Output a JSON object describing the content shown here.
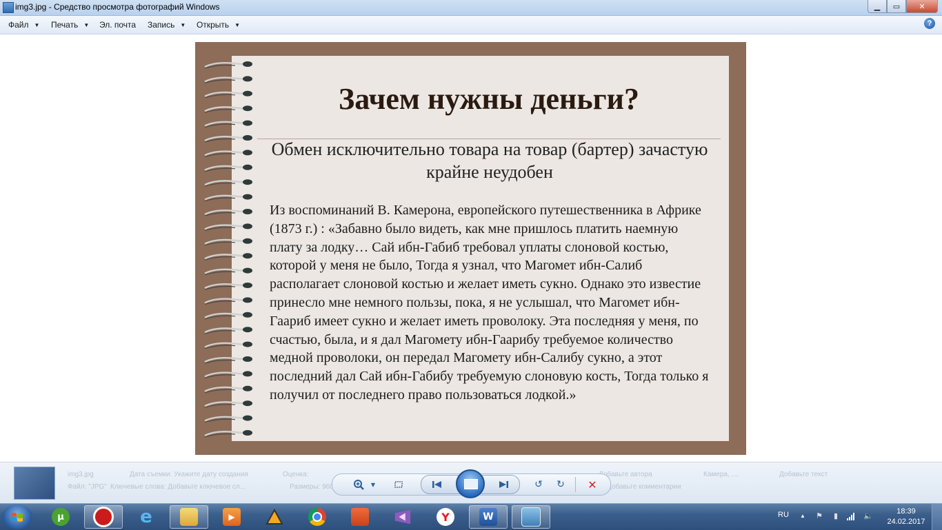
{
  "window": {
    "title": "img3.jpg - Средство просмотра фотографий Windows",
    "buttons": {
      "minimize": "▁",
      "maximize": "▭",
      "close": "✕"
    }
  },
  "menu": {
    "file": "Файл",
    "print": "Печать",
    "email": "Эл. почта",
    "burn": "Запись",
    "open": "Открыть",
    "help": "?"
  },
  "slide": {
    "title": "Зачем нужны деньги?",
    "subtitle": "Обмен исключительно товара на товар (бартер) зачастую крайне неудобен",
    "body": "Из воспоминаний В. Камерона, европейского путешественника в Африке (1873 г.) : «Забавно было видеть, как мне пришлось платить наемную плату за лодку… Сай ибн-Габиб требовал уплаты слоновой костью, которой у меня не было, Тогда я узнал, что Магомет ибн-Салиб располагает слоновой костью и желает иметь сукно. Однако это известие принесло мне немного пользы, пока, я не услышал, что Магомет ибн-Гаариб имеет сукно и желает иметь проволоку. Эта последняя у меня, по счастью, была, и я дал Магомету ибн-Гаарибу требуемое количество медной проволоки, он передал Магомету ибн-Салибу сукно, а этот последний дал Сай ибн-Габибу требуемую слоновую кость, Тогда только я получил от последнего право пользоваться лодкой.»"
  },
  "infobar": {
    "filename": "img3.jpg",
    "date_taken": "Дата съемки: Укажите дату создания",
    "rating": "Оценка:",
    "author": "Добавьте автора",
    "camera": "Камера, ....",
    "tags": "Добавьте текст",
    "size_label": "Файл: \"JPG\"",
    "keywords": "Ключевые слова: Добавьте ключевое сл...",
    "dims": "Размеры: 960 x 720",
    "comment": "Добавьте комментарии"
  },
  "controls": {
    "zoom": "🔍",
    "fit": "⬚",
    "prev": "⏮",
    "next": "⏭",
    "rotate_ccw": "↺",
    "rotate_cw": "↻",
    "delete": "✕"
  },
  "taskbar": {
    "apps": [
      "utorrent",
      "opera",
      "internet-explorer",
      "file-explorer",
      "media-player",
      "aimp",
      "chrome",
      "presentation-app",
      "visual-studio",
      "yandex-browser",
      "word",
      "photo-viewer"
    ],
    "language": "RU",
    "time": "18:39",
    "date": "24.02.2017"
  },
  "colors": {
    "frame": "#8d6c58",
    "paper": "#ece7e2",
    "title_text": "#2a1a10"
  }
}
